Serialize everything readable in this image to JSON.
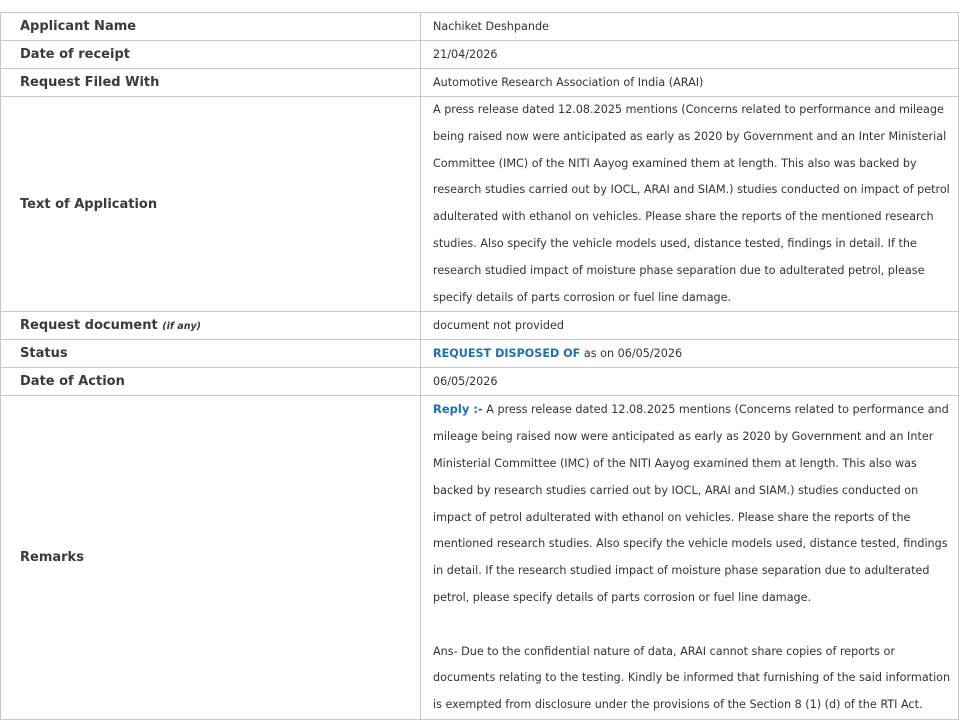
{
  "rows": {
    "applicant_name": {
      "label": "Applicant Name",
      "value": "Nachiket Deshpande"
    },
    "date_of_receipt": {
      "label": "Date of receipt",
      "value": "21/04/2026"
    },
    "request_filed_with": {
      "label": "Request Filed With",
      "value": "Automotive Research Association of India (ARAI)"
    },
    "text_of_application": {
      "label": "Text of Application",
      "value": "A press release dated 12.08.2025 mentions (Concerns related to performance and mileage being raised now were anticipated as early as 2020 by Government and an Inter Ministerial Committee (IMC) of the NITI Aayog examined them at length. This also was backed by research studies carried out by IOCL, ARAI and SIAM.) studies conducted on impact of petrol adulterated with ethanol on vehicles. Please share the reports of the mentioned research studies. Also specify the vehicle models used, distance tested, findings in detail. If the research studied impact of moisture phase separation due to adulterated petrol, please specify details of parts corrosion or fuel line damage."
    },
    "request_document": {
      "label": "Request document",
      "label_note": "(if any)",
      "value": "document not provided"
    },
    "status": {
      "label": "Status",
      "status_text": "REQUEST DISPOSED OF",
      "as_on": "as on 06/05/2026"
    },
    "date_of_action": {
      "label": "Date of Action",
      "value": "06/05/2026"
    },
    "remarks": {
      "label": "Remarks",
      "reply_label": "Reply :-",
      "reply_text": " A press release dated 12.08.2025 mentions (Concerns related to performance and mileage being raised now were anticipated as early as 2020 by Government and an Inter Ministerial Committee (IMC) of the NITI Aayog examined them at length. This also was backed by research studies carried out by IOCL, ARAI and SIAM.) studies conducted on impact of petrol adulterated with ethanol on vehicles. Please share the reports of the mentioned research studies. Also specify the vehicle models used, distance tested, findings in detail. If the research studied impact of moisture phase separation due to adulterated petrol, please specify details of parts corrosion or fuel line damage.",
      "answer_text": "Ans- Due to the confidential nature of data, ARAI cannot share copies of reports or documents relating to the testing. Kindly be informed that furnishing of the said information is exempted from disclosure under the provisions of the Section 8 (1) (d) of the RTI Act."
    }
  },
  "colors": {
    "border": "#c8c8c8",
    "label_text": "#3a3a3a",
    "status_blue": "#1f6fae",
    "remarks_green": "#1a7a1a"
  }
}
